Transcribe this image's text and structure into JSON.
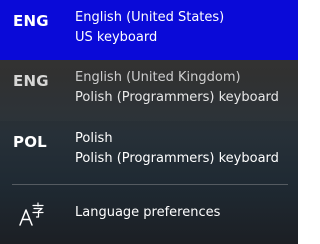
{
  "languages": [
    {
      "code": "ENG",
      "name": "English (United States)",
      "keyboard": "US keyboard",
      "selected": true
    },
    {
      "code": "ENG",
      "name": "English (United Kingdom)",
      "keyboard": "Polish (Programmers) keyboard",
      "selected": false
    },
    {
      "code": "POL",
      "name": "Polish",
      "keyboard": "Polish (Programmers) keyboard",
      "selected": false
    }
  ],
  "preferences": {
    "label": "Language preferences",
    "icon": "language-settings-icon"
  },
  "colors": {
    "accent": "#0a0ad8",
    "background": "#2d2d2d",
    "text": "#ffffff"
  }
}
